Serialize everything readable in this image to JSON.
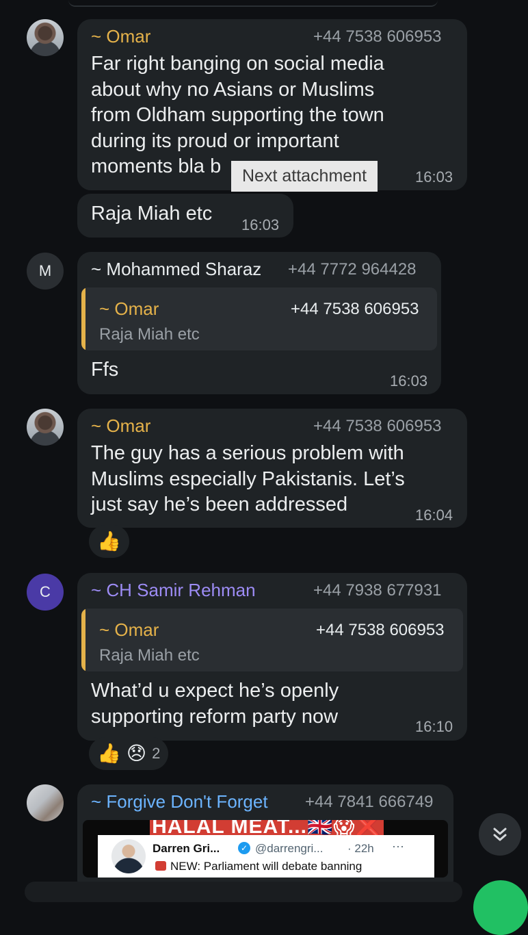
{
  "tooltip": {
    "label": "Next attachment"
  },
  "messages": [
    {
      "sender": "~ Omar",
      "phone": "+44 7538 606953",
      "text": "Far right banging on social media\nabout why no Asians or Muslims\nfrom Oldham supporting the town\nduring its proud or important\nmoments bla b",
      "time": "16:03"
    },
    {
      "text": "Raja Miah etc",
      "time": "16:03"
    },
    {
      "avatar_letter": "M",
      "sender": "~ Mohammed Sharaz",
      "phone": "+44 7772 964428",
      "quote": {
        "sender": "~ Omar",
        "phone": "+44 7538 606953",
        "text": "Raja Miah etc"
      },
      "text": "Ffs",
      "time": "16:03"
    },
    {
      "sender": "~ Omar",
      "phone": "+44 7538 606953",
      "text": "The guy has a serious problem with\nMuslims especially Pakistanis. Let’s\njust say he’s been addressed",
      "time": "16:04",
      "reactions": [
        "👍"
      ]
    },
    {
      "avatar_letter": "C",
      "sender": "~ CH Samir Rehman",
      "phone": "+44 7938 677931",
      "quote": {
        "sender": "~ Omar",
        "phone": "+44 7538 606953",
        "text": "Raja Miah etc"
      },
      "text": "What’d u expect he’s openly\nsupporting reform party now",
      "time": "16:10",
      "reactions": [
        "👍",
        "😞"
      ],
      "reaction_count": "2"
    },
    {
      "sender": "~ Forgive Don't Forget",
      "phone": "+44 7841 666749",
      "preview": {
        "banner": "HALAL MEAT...🇬🇧😱❌",
        "tweet_name": "Darren Gri...",
        "tweet_handle": "@darrengri...",
        "tweet_time": "· 22h",
        "tweet_more": "···",
        "tweet_text": "NEW: Parliament will debate banning"
      }
    }
  ],
  "scroll_button": {
    "icon": "double-chevron-down-icon"
  },
  "colors": {
    "background": "#0e1013",
    "bubble": "#1f2326",
    "quote_accent": "#e5b24a",
    "sender_purple": "#9d8cf5",
    "sender_blue": "#6cb4ff",
    "fab_green": "#21c063"
  }
}
